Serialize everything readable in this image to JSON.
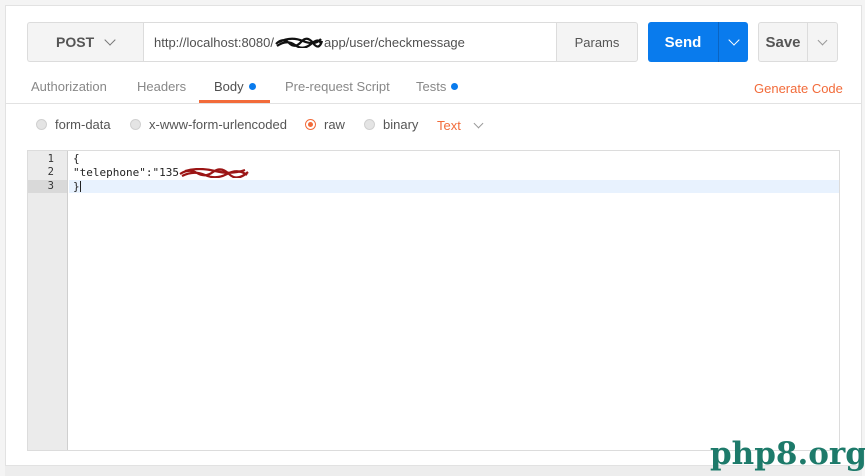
{
  "request": {
    "method": "POST",
    "url_prefix": "http://localhost:8080/",
    "url_suffix": "app/user/checkmessage",
    "params_label": "Params",
    "send_label": "Send",
    "save_label": "Save"
  },
  "tabs": [
    {
      "label": "Authorization",
      "active": false,
      "dot": false
    },
    {
      "label": "Headers",
      "active": false,
      "dot": false
    },
    {
      "label": "Body",
      "active": true,
      "dot": true
    },
    {
      "label": "Pre-request Script",
      "active": false,
      "dot": false
    },
    {
      "label": "Tests",
      "active": false,
      "dot": true
    }
  ],
  "generate_code_label": "Generate Code",
  "body_options": [
    {
      "label": "form-data",
      "selected": false
    },
    {
      "label": "x-www-form-urlencoded",
      "selected": false
    },
    {
      "label": "raw",
      "selected": true
    },
    {
      "label": "binary",
      "selected": false
    }
  ],
  "raw_type": "Text",
  "editor": {
    "line_numbers": [
      "1",
      "2",
      "3"
    ],
    "lines": [
      "{",
      "\"telephone\":\"135",
      "}"
    ],
    "active_line": 3
  },
  "watermark": "php8.org",
  "colors": {
    "accent": "#f26b3a",
    "send_blue": "#097bed",
    "dot_blue": "#097bed"
  }
}
